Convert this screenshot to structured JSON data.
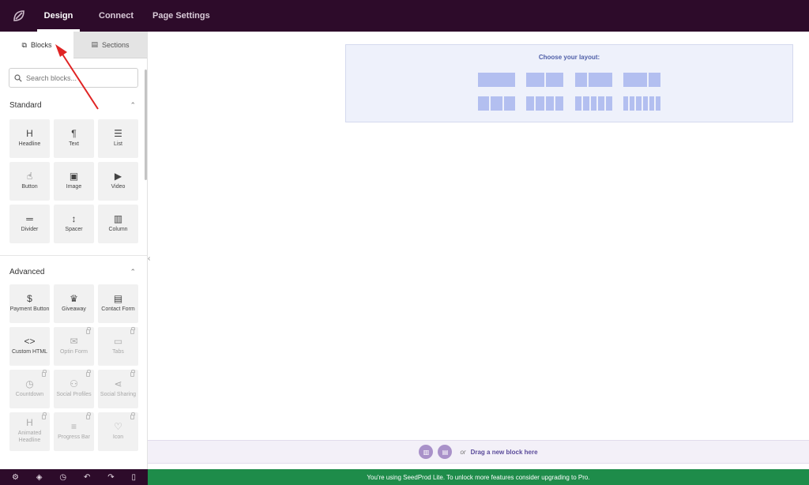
{
  "topbar": {
    "tabs": [
      {
        "label": "Design",
        "active": true
      },
      {
        "label": "Connect",
        "active": false
      },
      {
        "label": "Page Settings",
        "active": false
      }
    ]
  },
  "sidebar": {
    "tabs": [
      {
        "label": "Blocks",
        "icon": "blocks-icon",
        "active": true
      },
      {
        "label": "Sections",
        "icon": "sections-icon",
        "active": false
      }
    ],
    "search": {
      "placeholder": "Search blocks..."
    },
    "standard": {
      "title": "Standard",
      "blocks": [
        {
          "label": "Headline",
          "icon": "headline-icon",
          "glyph": "H"
        },
        {
          "label": "Text",
          "icon": "paragraph-icon",
          "glyph": "¶"
        },
        {
          "label": "List",
          "icon": "list-icon",
          "glyph": "☰"
        },
        {
          "label": "Button",
          "icon": "pointer-icon",
          "glyph": "☝"
        },
        {
          "label": "Image",
          "icon": "image-icon",
          "glyph": "▣"
        },
        {
          "label": "Video",
          "icon": "video-icon",
          "glyph": "▶"
        },
        {
          "label": "Divider",
          "icon": "divider-icon",
          "glyph": "═"
        },
        {
          "label": "Spacer",
          "icon": "spacer-icon",
          "glyph": "↕"
        },
        {
          "label": "Column",
          "icon": "column-icon",
          "glyph": "▥"
        }
      ]
    },
    "advanced": {
      "title": "Advanced",
      "blocks": [
        {
          "label": "Payment Button",
          "icon": "payment-icon",
          "glyph": "$",
          "locked": false
        },
        {
          "label": "Giveaway",
          "icon": "giveaway-icon",
          "glyph": "♛",
          "locked": false
        },
        {
          "label": "Contact Form",
          "icon": "form-icon",
          "glyph": "▤",
          "locked": false
        },
        {
          "label": "Custom HTML",
          "icon": "code-icon",
          "glyph": "<>",
          "locked": false
        },
        {
          "label": "Optin Form",
          "icon": "mail-icon",
          "glyph": "✉",
          "locked": true
        },
        {
          "label": "Tabs",
          "icon": "tabs-icon",
          "glyph": "▭",
          "locked": true
        },
        {
          "label": "Countdown",
          "icon": "stopwatch-icon",
          "glyph": "◷",
          "locked": true
        },
        {
          "label": "Social Profiles",
          "icon": "users-icon",
          "glyph": "⚇",
          "locked": true
        },
        {
          "label": "Social Sharing",
          "icon": "share-icon",
          "glyph": "⋖",
          "locked": true
        },
        {
          "label": "Animated Headline",
          "icon": "animated-headline-icon",
          "glyph": "H",
          "locked": true
        },
        {
          "label": "Progress Bar",
          "icon": "progress-bar-icon",
          "glyph": "≡",
          "locked": true
        },
        {
          "label": "Icon",
          "icon": "heart-icon",
          "glyph": "♡",
          "locked": true
        }
      ]
    }
  },
  "canvas": {
    "layout_title": "Choose your layout:",
    "drop_or": "or",
    "drop_link": "Drag a new block here"
  },
  "notice": "You're using SeedProd Lite. To unlock more features consider upgrading to Pro.",
  "colors": {
    "topbar": "#2d0b2a",
    "accent": "#5a4b9a",
    "notice": "#1e8c4a",
    "layout_cell": "#b3bff0"
  }
}
